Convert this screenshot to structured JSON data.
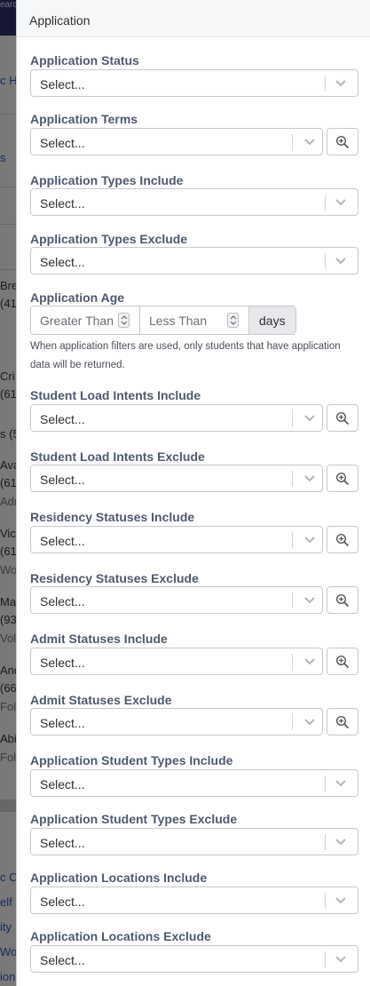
{
  "background": {
    "topbar_text": "earc",
    "items": [
      {
        "text": "c H",
        "style": "link"
      },
      {
        "text": "s",
        "style": "link"
      },
      {
        "text": "Bre",
        "style": "normal"
      },
      {
        "text": "(41",
        "style": "normal"
      },
      {
        "text": "Cri",
        "style": "normal"
      },
      {
        "text": "(61",
        "style": "normal"
      },
      {
        "text": "s (5",
        "style": "normal"
      },
      {
        "text": "Ava",
        "style": "normal"
      },
      {
        "text": "(61",
        "style": "normal"
      },
      {
        "text": "Adr",
        "style": "muted"
      },
      {
        "text": "Vic",
        "style": "normal"
      },
      {
        "text": "(61",
        "style": "normal"
      },
      {
        "text": "Wo",
        "style": "muted"
      },
      {
        "text": "Ma",
        "style": "normal"
      },
      {
        "text": "(93",
        "style": "normal"
      },
      {
        "text": "Vol",
        "style": "muted"
      },
      {
        "text": "And",
        "style": "normal"
      },
      {
        "text": "(66",
        "style": "normal"
      },
      {
        "text": "Fol",
        "style": "muted"
      },
      {
        "text": "Abi",
        "style": "normal"
      },
      {
        "text": "Fol",
        "style": "muted"
      },
      {
        "text": "c C",
        "style": "link"
      },
      {
        "text": "elf",
        "style": "link"
      },
      {
        "text": "ity",
        "style": "link"
      },
      {
        "text": "Wor",
        "style": "link"
      },
      {
        "text": "ion",
        "style": "link"
      }
    ]
  },
  "panel": {
    "title": "Application",
    "placeholder": "Select...",
    "filters": [
      {
        "label": "Application Status",
        "lookup": false
      },
      {
        "label": "Application Terms",
        "lookup": true
      },
      {
        "label": "Application Types Include",
        "lookup": false
      },
      {
        "label": "Application Types Exclude",
        "lookup": false
      },
      {
        "label": "Application Age",
        "type": "age"
      },
      {
        "label": "Student Load Intents Include",
        "lookup": true
      },
      {
        "label": "Student Load Intents Exclude",
        "lookup": true
      },
      {
        "label": "Residency Statuses Include",
        "lookup": true
      },
      {
        "label": "Residency Statuses Exclude",
        "lookup": true
      },
      {
        "label": "Admit Statuses Include",
        "lookup": true
      },
      {
        "label": "Admit Statuses Exclude",
        "lookup": true
      },
      {
        "label": "Application Student Types Include",
        "lookup": false
      },
      {
        "label": "Application Student Types Exclude",
        "lookup": false
      },
      {
        "label": "Application Locations Include",
        "lookup": false
      },
      {
        "label": "Application Locations Exclude",
        "lookup": false
      }
    ],
    "age": {
      "greater_placeholder": "Greater Than",
      "less_placeholder": "Less Than",
      "unit": "days",
      "help_text": "When application filters are used, only students that have application data will be returned."
    }
  },
  "icons": {
    "chevron": "chevron-down-icon",
    "lookup": "magnifier-plus-icon",
    "spinner": "spinner-arrows-icon"
  },
  "colors": {
    "label": "#4f5a6e",
    "border": "#c6c9cf",
    "header_bg": "#f6f7f9",
    "addon_bg": "#e7e8eb",
    "topbar": "#2a2f6b"
  }
}
